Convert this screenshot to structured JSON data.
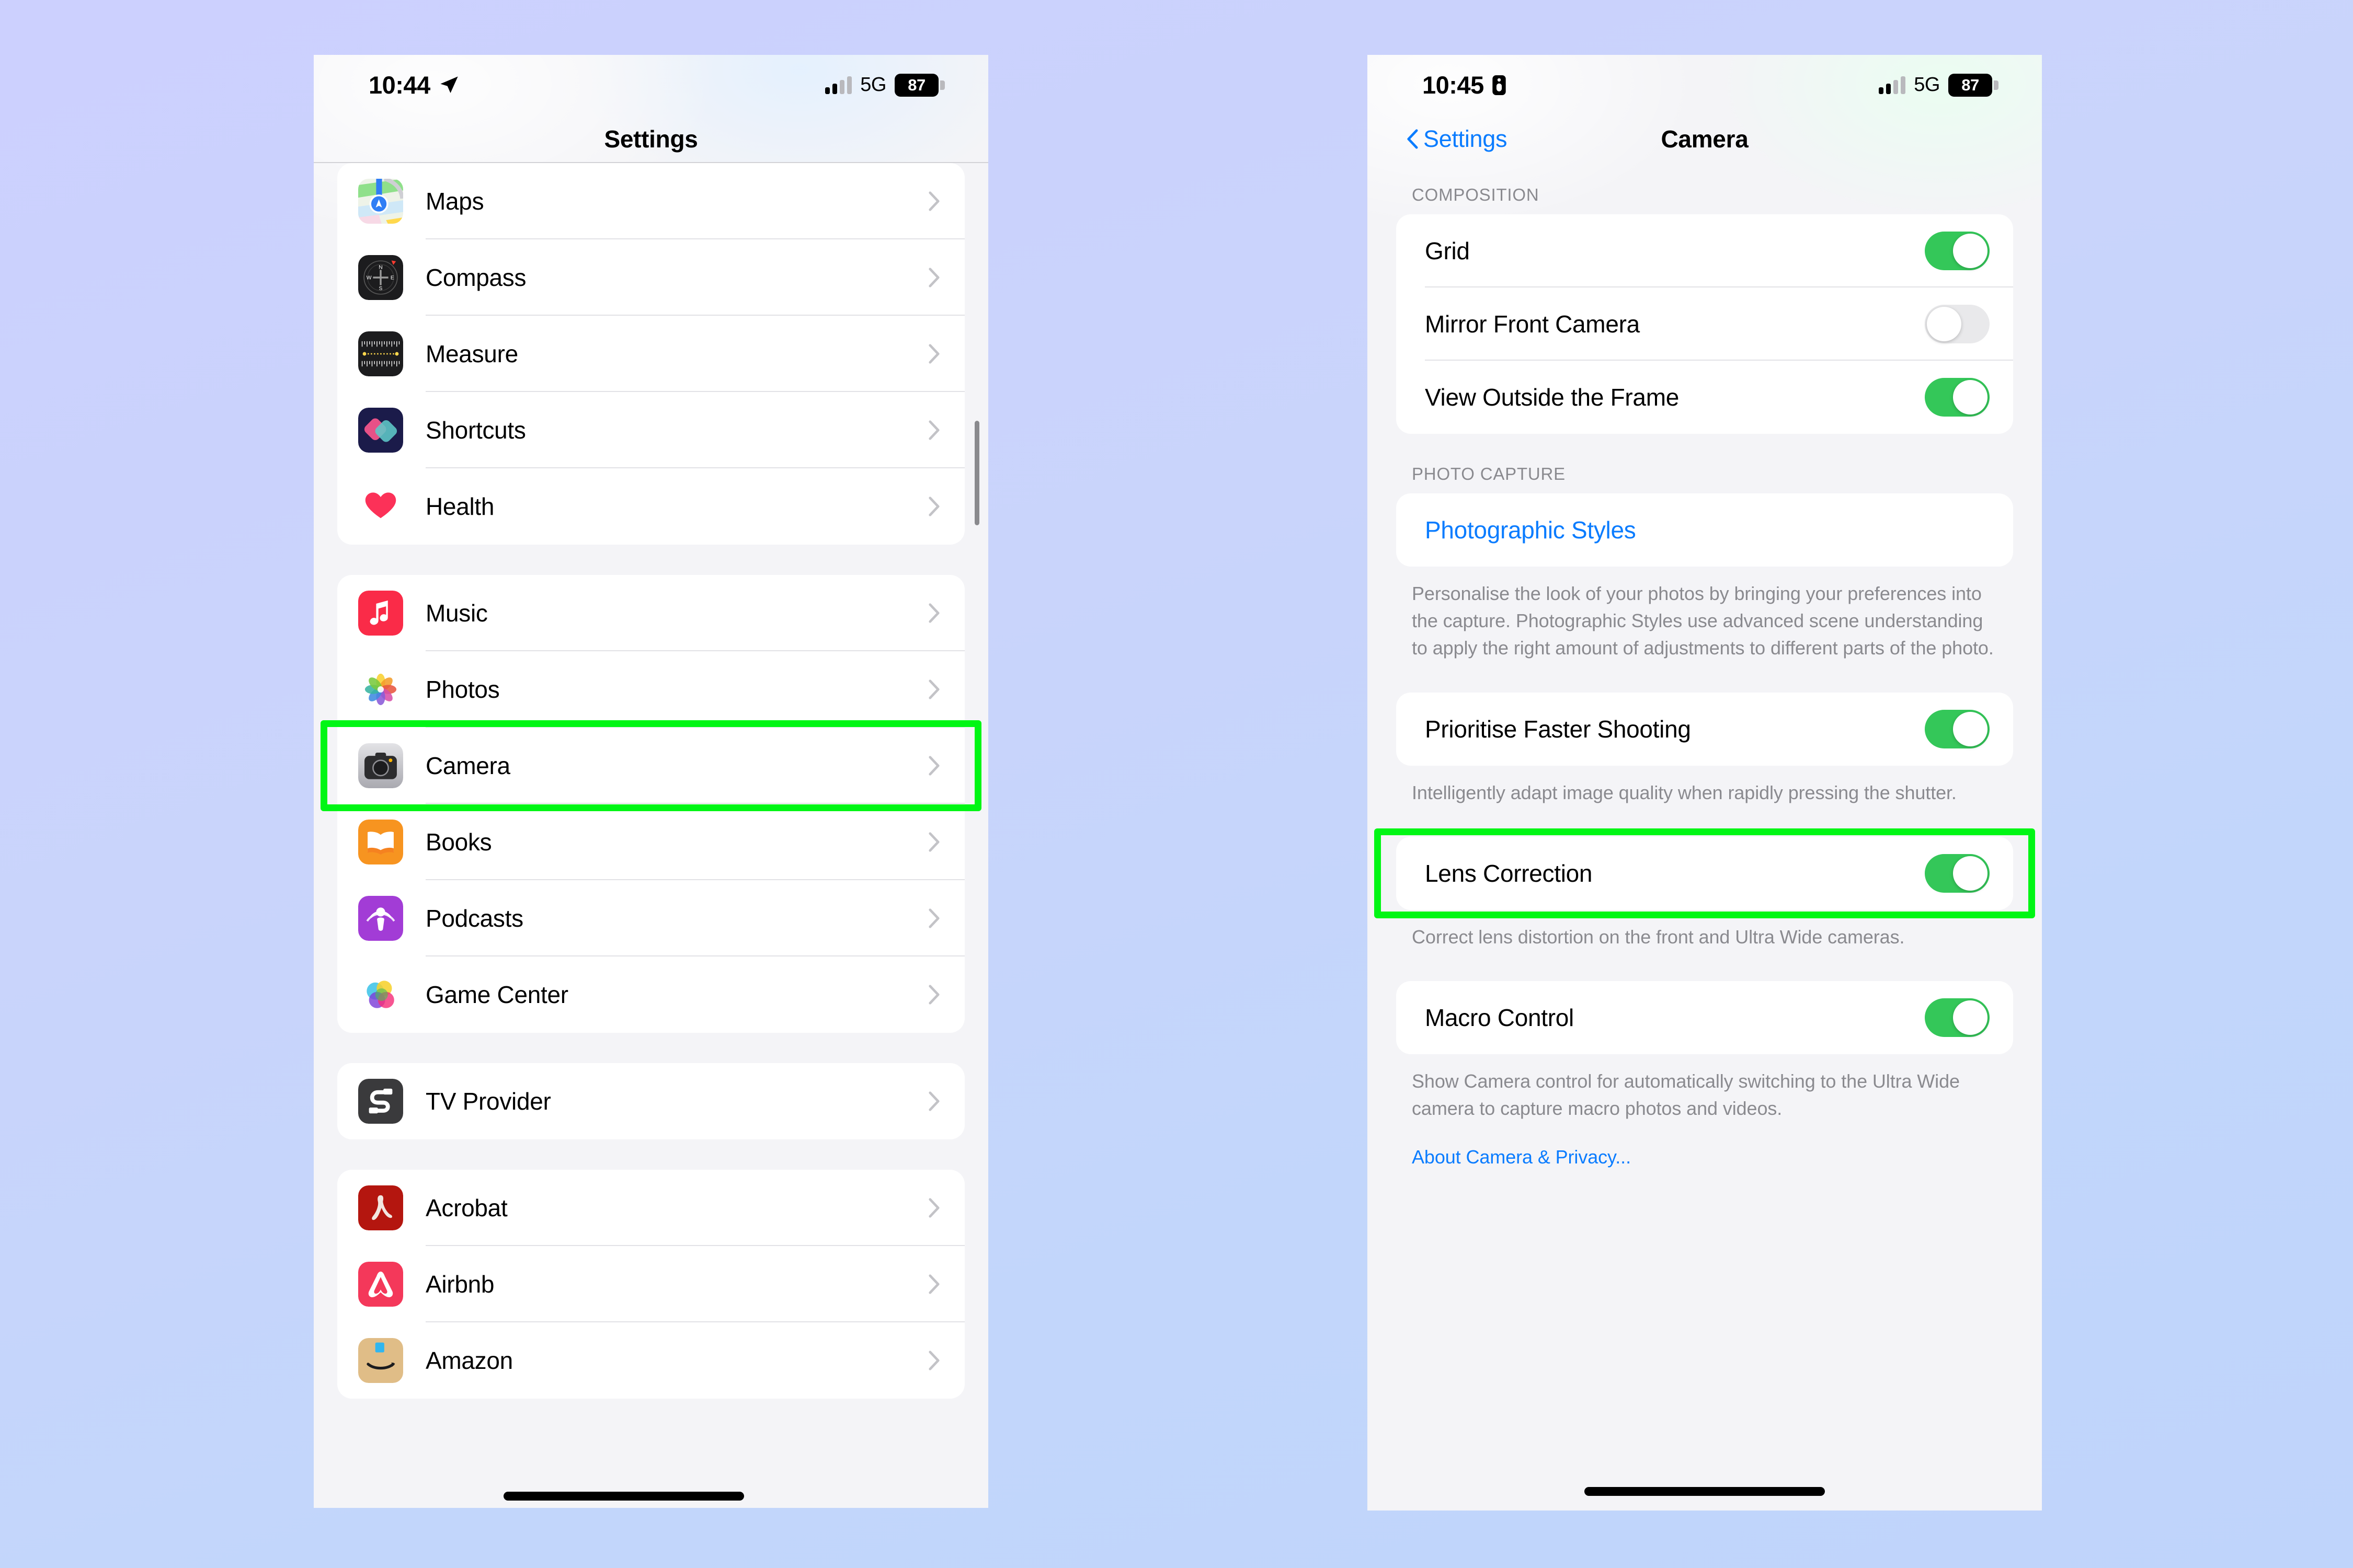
{
  "background_color": "#ccd0fe",
  "highlight_color": "#00f615",
  "accent_color": "#0a7cff",
  "toggle_on_color": "#34c759",
  "left_phone": {
    "status_bar": {
      "time": "10:44",
      "location_icon": "location-arrow-icon",
      "signal_icon": "cellular-signal-icon",
      "network": "5G",
      "battery_percent": "87"
    },
    "nav": {
      "title": "Settings"
    },
    "groups": [
      {
        "rows": [
          {
            "label": "Maps",
            "icon": "maps-app-icon"
          },
          {
            "label": "Compass",
            "icon": "compass-app-icon"
          },
          {
            "label": "Measure",
            "icon": "measure-app-icon"
          },
          {
            "label": "Shortcuts",
            "icon": "shortcuts-app-icon"
          },
          {
            "label": "Health",
            "icon": "health-app-icon"
          }
        ]
      },
      {
        "rows": [
          {
            "label": "Music",
            "icon": "music-app-icon"
          },
          {
            "label": "Photos",
            "icon": "photos-app-icon"
          },
          {
            "label": "Camera",
            "icon": "camera-app-icon",
            "highlighted": true
          },
          {
            "label": "Books",
            "icon": "books-app-icon"
          },
          {
            "label": "Podcasts",
            "icon": "podcasts-app-icon"
          },
          {
            "label": "Game Center",
            "icon": "game-center-app-icon"
          }
        ]
      },
      {
        "rows": [
          {
            "label": "TV Provider",
            "icon": "tv-provider-app-icon"
          }
        ]
      },
      {
        "rows": [
          {
            "label": "Acrobat",
            "icon": "acrobat-app-icon"
          },
          {
            "label": "Airbnb",
            "icon": "airbnb-app-icon"
          },
          {
            "label": "Amazon",
            "icon": "amazon-app-icon"
          }
        ]
      }
    ]
  },
  "right_phone": {
    "status_bar": {
      "time": "10:45",
      "recording_icon": "screen-recording-icon",
      "signal_icon": "cellular-signal-icon",
      "network": "5G",
      "battery_percent": "87"
    },
    "nav": {
      "back_label": "Settings",
      "title": "Camera"
    },
    "sections": [
      {
        "header": "COMPOSITION",
        "rows": [
          {
            "label": "Grid",
            "toggle": true
          },
          {
            "label": "Mirror Front Camera",
            "toggle": false
          },
          {
            "label": "View Outside the Frame",
            "toggle": true
          }
        ]
      },
      {
        "header": "PHOTO CAPTURE",
        "rows": [
          {
            "label": "Photographic Styles",
            "type": "link"
          }
        ],
        "footer": "Personalise the look of your photos by bringing your preferences into the capture. Photographic Styles use advanced scene understanding to apply the right amount of adjustments to different parts of the photo."
      },
      {
        "rows": [
          {
            "label": "Prioritise Faster Shooting",
            "toggle": true
          }
        ],
        "footer": "Intelligently adapt image quality when rapidly pressing the shutter."
      },
      {
        "rows": [
          {
            "label": "Lens Correction",
            "toggle": true,
            "highlighted": true
          }
        ],
        "footer": "Correct lens distortion on the front and Ultra Wide cameras."
      },
      {
        "rows": [
          {
            "label": "Macro Control",
            "toggle": true
          }
        ],
        "footer": "Show Camera control for automatically switching to the Ultra Wide camera to capture macro photos and videos."
      }
    ],
    "about_link": "About Camera & Privacy..."
  }
}
